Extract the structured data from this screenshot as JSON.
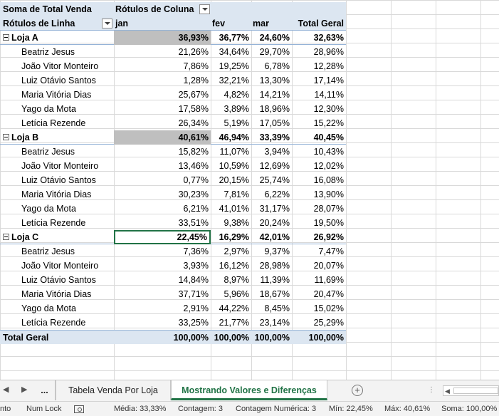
{
  "pivot": {
    "header1": {
      "label": "Soma de Total Venda",
      "col_label": "Rótulos de Coluna"
    },
    "header2": {
      "label": "Rótulos de Linha",
      "jan": "jan",
      "fev": "fev",
      "mar": "mar",
      "total": "Total Geral"
    },
    "groups": [
      {
        "name": "Loja A",
        "jan": "36,93%",
        "fev": "36,77%",
        "mar": "24,60%",
        "total": "32,63%",
        "rows": [
          {
            "name": "Beatriz Jesus",
            "jan": "21,26%",
            "fev": "34,64%",
            "mar": "29,70%",
            "total": "28,96%"
          },
          {
            "name": "João Vitor Monteiro",
            "jan": "7,86%",
            "fev": "19,25%",
            "mar": "6,78%",
            "total": "12,28%"
          },
          {
            "name": "Luiz Otávio Santos",
            "jan": "1,28%",
            "fev": "32,21%",
            "mar": "13,30%",
            "total": "17,14%"
          },
          {
            "name": "Maria Vitória Dias",
            "jan": "25,67%",
            "fev": "4,82%",
            "mar": "14,21%",
            "total": "14,11%"
          },
          {
            "name": "Yago da Mota",
            "jan": "17,58%",
            "fev": "3,89%",
            "mar": "18,96%",
            "total": "12,30%"
          },
          {
            "name": "Letícia Rezende",
            "jan": "26,34%",
            "fev": "5,19%",
            "mar": "17,05%",
            "total": "15,22%"
          }
        ]
      },
      {
        "name": "Loja B",
        "jan": "40,61%",
        "fev": "46,94%",
        "mar": "33,39%",
        "total": "40,45%",
        "rows": [
          {
            "name": "Beatriz Jesus",
            "jan": "15,82%",
            "fev": "11,07%",
            "mar": "3,94%",
            "total": "10,43%"
          },
          {
            "name": "João Vitor Monteiro",
            "jan": "13,46%",
            "fev": "10,59%",
            "mar": "12,69%",
            "total": "12,02%"
          },
          {
            "name": "Luiz Otávio Santos",
            "jan": "0,77%",
            "fev": "20,15%",
            "mar": "25,74%",
            "total": "16,08%"
          },
          {
            "name": "Maria Vitória Dias",
            "jan": "30,23%",
            "fev": "7,81%",
            "mar": "6,22%",
            "total": "13,90%"
          },
          {
            "name": "Yago da Mota",
            "jan": "6,21%",
            "fev": "41,01%",
            "mar": "31,17%",
            "total": "28,07%"
          },
          {
            "name": "Letícia Rezende",
            "jan": "33,51%",
            "fev": "9,38%",
            "mar": "20,24%",
            "total": "19,50%"
          }
        ]
      },
      {
        "name": "Loja C",
        "jan": "22,45%",
        "fev": "16,29%",
        "mar": "42,01%",
        "total": "26,92%",
        "rows": [
          {
            "name": "Beatriz Jesus",
            "jan": "7,36%",
            "fev": "2,97%",
            "mar": "9,37%",
            "total": "7,47%"
          },
          {
            "name": "João Vitor Monteiro",
            "jan": "3,93%",
            "fev": "16,12%",
            "mar": "28,98%",
            "total": "20,07%"
          },
          {
            "name": "Luiz Otávio Santos",
            "jan": "14,84%",
            "fev": "8,97%",
            "mar": "11,39%",
            "total": "11,69%"
          },
          {
            "name": "Maria Vitória Dias",
            "jan": "37,71%",
            "fev": "5,96%",
            "mar": "18,67%",
            "total": "20,47%"
          },
          {
            "name": "Yago da Mota",
            "jan": "2,91%",
            "fev": "44,22%",
            "mar": "8,45%",
            "total": "15,02%"
          },
          {
            "name": "Letícia Rezende",
            "jan": "33,25%",
            "fev": "21,77%",
            "mar": "23,14%",
            "total": "25,29%"
          }
        ]
      }
    ],
    "grand_total": {
      "name": "Total Geral",
      "jan": "100,00%",
      "fev": "100,00%",
      "mar": "100,00%",
      "total": "100,00%"
    }
  },
  "sheet_tabs": {
    "more": "...",
    "tabs": [
      {
        "label": "Tabela Venda Por Loja",
        "active": false
      },
      {
        "label": "Mostrando Valores e Diferenças",
        "active": true
      }
    ]
  },
  "status_bar": {
    "mode": "nto",
    "num_lock": "Num Lock",
    "media": "Média: 33,33%",
    "contagem": "Contagem: 3",
    "contagem_numerica": "Contagem Numérica: 3",
    "min": "Mín: 22,45%",
    "max": "Máx: 40,61%",
    "soma": "Soma: 100,00%"
  },
  "colors": {
    "pivot_header_bg": "#dce6f1",
    "pivot_border": "#95b3d7",
    "active_tab": "#217346",
    "selected_cell": "#bfbfbf"
  }
}
